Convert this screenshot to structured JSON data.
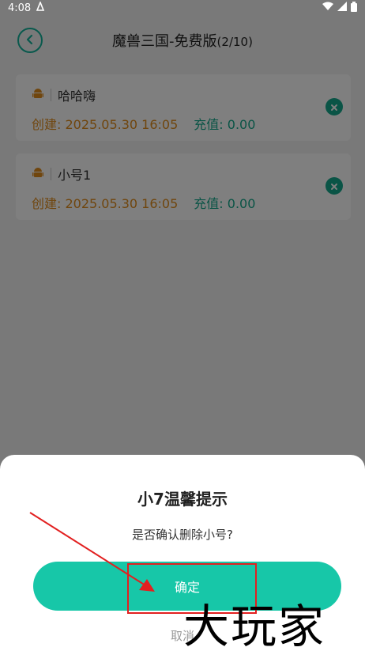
{
  "status_bar": {
    "time": "4:08"
  },
  "header": {
    "title": "魔兽三国-免费版",
    "count": "(2/10)"
  },
  "accounts": [
    {
      "name": "哈哈嗨",
      "created": "创建: 2025.05.30 16:05",
      "recharge": "充值: 0.00"
    },
    {
      "name": "小号1",
      "created": "创建: 2025.05.30 16:05",
      "recharge": "充值: 0.00"
    }
  ],
  "dialog": {
    "title": "小7温馨提示",
    "message": "是否确认删除小号?",
    "confirm_label": "确定",
    "cancel_label": "取消"
  },
  "watermark": "大玩家",
  "colors": {
    "accent": "#17c7a8",
    "created": "#e08c1c",
    "recharge": "#14a98c",
    "annotation": "#e22020"
  }
}
